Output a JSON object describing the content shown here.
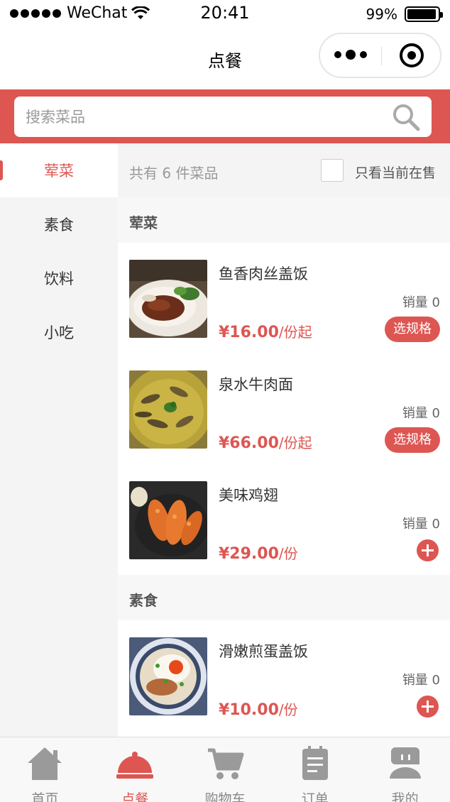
{
  "status_bar": {
    "carrier": "WeChat",
    "time": "20:41",
    "battery": "99%"
  },
  "nav": {
    "title": "点餐"
  },
  "search": {
    "placeholder": "搜索菜品"
  },
  "sidebar": {
    "items": [
      {
        "label": "荤菜",
        "active": true
      },
      {
        "label": "素食",
        "active": false
      },
      {
        "label": "饮料",
        "active": false
      },
      {
        "label": "小吃",
        "active": false
      }
    ]
  },
  "summary": {
    "count_text": "共有 6 件菜品",
    "filter_label": "只看当前在售"
  },
  "sections": [
    {
      "title": "荤菜",
      "items": [
        {
          "name": "鱼香肉丝盖饭",
          "sales": "销量 0",
          "price": "¥16.00",
          "unit": "/份起",
          "action": "选规格"
        },
        {
          "name": "泉水牛肉面",
          "sales": "销量 0",
          "price": "¥66.00",
          "unit": "/份起",
          "action": "选规格"
        },
        {
          "name": "美味鸡翅",
          "sales": "销量 0",
          "price": "¥29.00",
          "unit": "/份",
          "action": "add"
        }
      ]
    },
    {
      "title": "素食",
      "items": [
        {
          "name": "滑嫩煎蛋盖饭",
          "sales": "销量 0",
          "price": "¥10.00",
          "unit": "/份",
          "action": "add"
        }
      ]
    }
  ],
  "tabs": [
    {
      "label": "首页",
      "icon": "home-icon",
      "active": false
    },
    {
      "label": "点餐",
      "icon": "cloche-icon",
      "active": true
    },
    {
      "label": "购物车",
      "icon": "cart-icon",
      "active": false
    },
    {
      "label": "订单",
      "icon": "order-icon",
      "active": false
    },
    {
      "label": "我的",
      "icon": "profile-icon",
      "active": false
    }
  ],
  "colors": {
    "accent": "#dd5652",
    "tab_inactive": "#888888",
    "sidebar_bg": "#f4f4f4"
  }
}
